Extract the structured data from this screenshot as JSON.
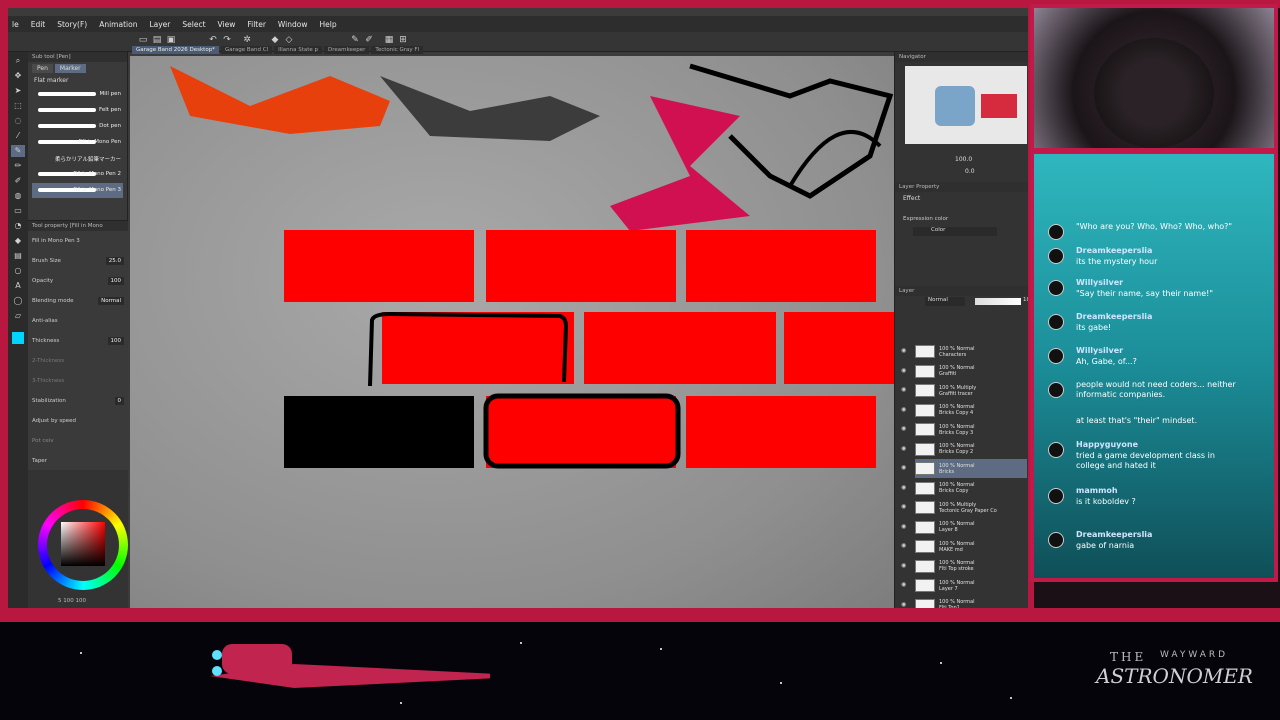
{
  "menu": [
    "le",
    "Edit",
    "Story(F)",
    "Animation",
    "Layer",
    "Select",
    "View",
    "Filter",
    "Window",
    "Help"
  ],
  "doc_tabs": [
    "Garage Band 2026 Desktop*",
    "Garage Band Cl",
    "Illanna State p",
    "Dreamkeeper",
    "Tectonic Gray Fl"
  ],
  "subtool": {
    "title": "Sub tool [Pen]",
    "tabs": [
      "Pen",
      "Marker"
    ],
    "group": "Flat marker",
    "brushes": [
      "Mill pen",
      "Felt pen",
      "Dot pen",
      "Fill in Mono Pen",
      "柔らかリアル鉛筆マーカー",
      "Fill in Mono Pen 2",
      "Fill in Mono Pen 3"
    ]
  },
  "tool_property": {
    "title": "Tool property [Fill in Mono",
    "brush_name": "Fill in Mono Pen 3",
    "rows": [
      {
        "label": "Brush Size",
        "value": "25.0"
      },
      {
        "label": "Opacity",
        "value": "100"
      },
      {
        "label": "Blending mode",
        "value": "Normal"
      },
      {
        "label": "Anti-alias",
        "value": ""
      },
      {
        "label": "Thickness",
        "value": "100"
      },
      {
        "label": "2-Thickness",
        "value": ""
      },
      {
        "label": "3-Thickness",
        "value": ""
      },
      {
        "label": "Stabilization",
        "value": "0"
      },
      {
        "label": "Adjust by speed",
        "value": ""
      },
      {
        "label": "Pot ceiv",
        "value": ""
      },
      {
        "label": "Taper",
        "value": ""
      }
    ]
  },
  "color_footer": "5 100 100",
  "navigator": {
    "title": "Navigator",
    "zoom": "100.0",
    "angle": "0.0"
  },
  "layer_property": {
    "title": "Layer Property",
    "effect": "Effect",
    "expression_color_label": "Expression color",
    "expression_color": "Color"
  },
  "layer_panel": {
    "title": "Layer",
    "blend": "Normal",
    "opacity_value": "10",
    "layers": [
      {
        "line1": "100 % Normal",
        "line2": "Characters"
      },
      {
        "line1": "100 % Normal",
        "line2": "Graffiti"
      },
      {
        "line1": "100 % Multiply",
        "line2": "Graffiti tracer"
      },
      {
        "line1": "100 % Normal",
        "line2": "Bricks Copy 4"
      },
      {
        "line1": "100 % Normal",
        "line2": "Bricks Copy 3"
      },
      {
        "line1": "100 % Normal",
        "line2": "Bricks Copy 2"
      },
      {
        "line1": "100 % Normal",
        "line2": "Bricks"
      },
      {
        "line1": "100 % Normal",
        "line2": "Bricks Copy"
      },
      {
        "line1": "100 % Multiply",
        "line2": "Tectonic Gray Paper Co"
      },
      {
        "line1": "100 % Normal",
        "line2": "Layer 8"
      },
      {
        "line1": "100 % Normal",
        "line2": "MAKE md"
      },
      {
        "line1": "100 % Normal",
        "line2": "Flti Top stroke"
      },
      {
        "line1": "100 % Normal",
        "line2": "Layer 7"
      },
      {
        "line1": "100 % Normal",
        "line2": "Flti Top1"
      }
    ]
  },
  "chat": [
    {
      "user": "",
      "text": "\"Who are you? Who, Who? Who, who?\""
    },
    {
      "user": "Dreamkeeperslia",
      "text": "its the mystery hour"
    },
    {
      "user": "Willysilver",
      "text": "\"Say their name, say their name!\""
    },
    {
      "user": "Dreamkeeperslia",
      "text": "its gabe!"
    },
    {
      "user": "Willysilver",
      "text": "Ah, Gabe, of...?"
    },
    {
      "user": "",
      "text": "people would not need coders... neither informatic companies."
    },
    {
      "user": "",
      "text": "at least that's \"their\" mindset."
    },
    {
      "user": "Happyguyone",
      "text": "tried a game development class in college and hated it"
    },
    {
      "user": "mammoh",
      "text": "is it koboldev ?"
    },
    {
      "user": "Dreamkeeperslia",
      "text": "gabe of narnia"
    }
  ],
  "banner": {
    "the": "THE",
    "wayward": "WAYWARD",
    "name": "ASTRONOMER"
  },
  "colors": {
    "frame": "#b8173f",
    "brick": "#ff0000",
    "chat_bg": "#2fb7bf",
    "accent_swatch": "#00d4ff"
  }
}
